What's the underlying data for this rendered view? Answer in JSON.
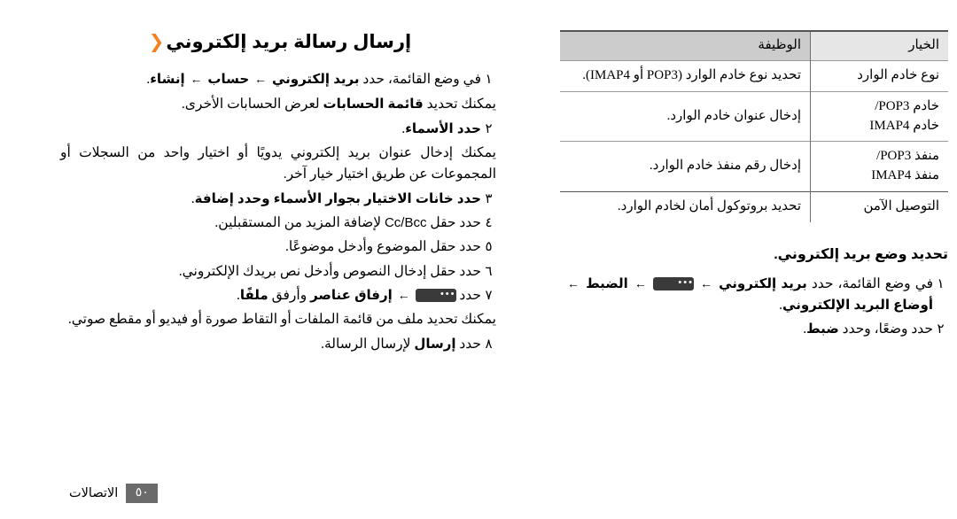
{
  "colors": {
    "accent": "#F58220",
    "table_header_option_bg": "#E6E6E6",
    "table_header_function_bg": "#CCCCCC",
    "key_glyph_bg": "#3A3A3A",
    "page_badge_bg": "#6B6B6B",
    "rule": "#9A9A9A"
  },
  "left_column": {
    "heading": "إرسال رسالة بريد إلكتروني",
    "chevron_icon": "chevron-left-icon",
    "steps": [
      {
        "num": "١",
        "parts": [
          {
            "t": "text",
            "v": "في وضع القائمة، حدد "
          },
          {
            "t": "bold",
            "v": "بريد إلكتروني"
          },
          {
            "t": "arrow",
            "v": "←"
          },
          {
            "t": "bold",
            "v": "حساب"
          },
          {
            "t": "arrow",
            "v": "←"
          },
          {
            "t": "bold",
            "v": "إنشاء"
          },
          {
            "t": "text",
            "v": "."
          }
        ],
        "note_parts": [
          {
            "t": "text",
            "v": "يمكنك تحديد "
          },
          {
            "t": "bold",
            "v": "قائمة الحسابات"
          },
          {
            "t": "text",
            "v": " لعرض الحسابات الأخرى."
          }
        ]
      },
      {
        "num": "٢",
        "parts": [
          {
            "t": "bold",
            "v": "حدد الأسماء"
          },
          {
            "t": "text",
            "v": "."
          }
        ],
        "note_parts": [
          {
            "t": "text",
            "v": "يمكنك إدخال عنوان بريد إلكتروني يدويًا أو اختيار واحد من السجلات أو المجموعات عن طريق اختيار خيار آخر."
          }
        ]
      },
      {
        "num": "٣",
        "parts": [
          {
            "t": "bold",
            "v": "حدد خانات الاختيار بجوار الأسماء وحدد إضافة"
          },
          {
            "t": "text",
            "v": "."
          }
        ]
      },
      {
        "num": "٤",
        "parts": [
          {
            "t": "text",
            "v": "حدد حقل "
          },
          {
            "t": "latin",
            "v": "Cc/Bcc"
          },
          {
            "t": "text",
            "v": " لإضافة المزيد من المستقبلين."
          }
        ]
      },
      {
        "num": "٥",
        "parts": [
          {
            "t": "text",
            "v": "حدد حقل الموضوع وأدخل موضوعًا."
          }
        ]
      },
      {
        "num": "٦",
        "parts": [
          {
            "t": "text",
            "v": "حدد حقل إدخال النصوص وأدخل نص بريدك الإلكتروني."
          }
        ]
      },
      {
        "num": "٧",
        "parts": [
          {
            "t": "text",
            "v": "حدد "
          },
          {
            "t": "key",
            "v": "•••"
          },
          {
            "t": "arrow",
            "v": "←"
          },
          {
            "t": "bold",
            "v": "إرفاق عناصر"
          },
          {
            "t": "text",
            "v": " وأرفق "
          },
          {
            "t": "bold",
            "v": "ملفًا"
          },
          {
            "t": "text",
            "v": "."
          }
        ],
        "note_parts": [
          {
            "t": "text",
            "v": "يمكنك تحديد ملف من قائمة الملفات أو التقاط صورة أو فيديو أو مقطع صوتي."
          }
        ]
      },
      {
        "num": "٨",
        "parts": [
          {
            "t": "text",
            "v": "حدد "
          },
          {
            "t": "bold",
            "v": "إرسال"
          },
          {
            "t": "text",
            "v": " لإرسال الرسالة."
          }
        ]
      }
    ]
  },
  "right_column": {
    "table": {
      "headers": [
        "الخيار",
        "الوظيفة"
      ],
      "rows": [
        {
          "option_lines": [
            "نوع خادم الوارد"
          ],
          "function": "تحديد نوع خادم الوارد (POP3 أو IMAP4)."
        },
        {
          "option_lines": [
            "خادم POP3/",
            "خادم IMAP4"
          ],
          "function": "إدخال عنوان خادم الوارد."
        },
        {
          "option_lines": [
            "منفذ POP3/",
            "منفذ IMAP4"
          ],
          "function": "إدخال رقم منفذ خادم الوارد."
        },
        {
          "option_lines": [
            "التوصيل الآمن"
          ],
          "function": "تحديد بروتوكول أمان لخادم الوارد."
        }
      ]
    },
    "heading": "تحديد وضع بريد إلكتروني.",
    "steps": [
      {
        "num": "١",
        "parts": [
          {
            "t": "text",
            "v": "في وضع القائمة، حدد "
          },
          {
            "t": "bold",
            "v": "بريد إلكتروني"
          },
          {
            "t": "arrow",
            "v": "←"
          },
          {
            "t": "key",
            "v": "•••"
          },
          {
            "t": "arrow",
            "v": "←"
          },
          {
            "t": "bold",
            "v": "الضبط"
          },
          {
            "t": "arrow",
            "v": "←"
          },
          {
            "t": "bold",
            "v": "أوضاع البريد الإلكتروني"
          },
          {
            "t": "text",
            "v": "."
          }
        ]
      },
      {
        "num": "٢",
        "parts": [
          {
            "t": "text",
            "v": "حدد وضعًا، وحدد "
          },
          {
            "t": "bold",
            "v": "ضبط"
          },
          {
            "t": "text",
            "v": "."
          }
        ]
      }
    ]
  },
  "footer": {
    "page_number": "٥٠",
    "section_label": "الاتصالات"
  }
}
